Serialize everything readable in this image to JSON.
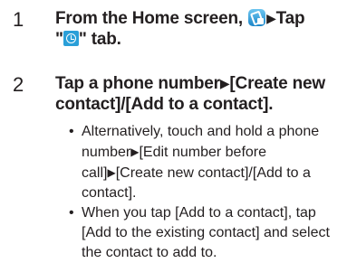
{
  "step1": {
    "number": "1",
    "text_before_icon": "From the Home screen, ",
    "app_icon": "contacts-app-icon",
    "arrow": "▶",
    "text_after_arrow": "Tap",
    "line2_quote_open": "\"",
    "tab_icon": "clock-history-icon",
    "line2_end": "\" tab."
  },
  "step2": {
    "number": "2",
    "title_part1": "Tap a phone number",
    "arrow": "▶",
    "title_part2": "[Create new contact]/[Add to a contact]."
  },
  "bullets": [
    {
      "part1": "Alternatively, touch and hold a phone number",
      "arrow1": "▶",
      "part2": "[Edit number before call]",
      "arrow2": "▶",
      "part3": "[Create new contact]/[Add to a contact]."
    },
    {
      "text": "When you tap [Add to a contact], tap [Add to the existing contact] and select the contact to add to."
    }
  ]
}
